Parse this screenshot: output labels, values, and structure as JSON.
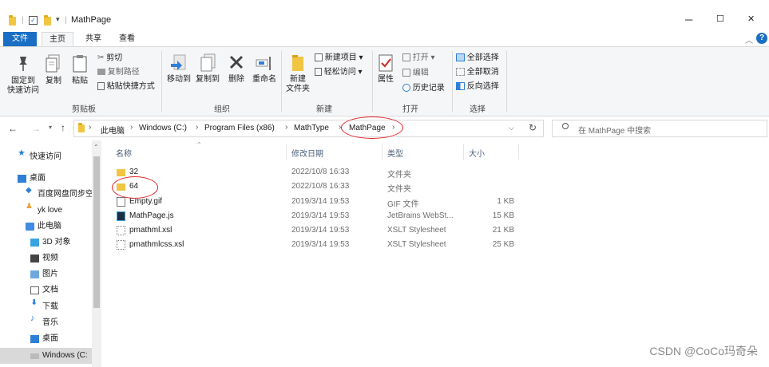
{
  "window": {
    "title": "MathPage",
    "minimize": "─",
    "maximize": "☐",
    "close": "✕"
  },
  "ribbon_tabs": [
    "文件",
    "主页",
    "共享",
    "查看"
  ],
  "ribbon": {
    "clipboard": {
      "pin": "固定到\n快速访问",
      "copy": "复制",
      "paste": "粘贴",
      "cut": "剪切",
      "copy_path": "复制路径",
      "paste_shortcut": "粘贴快捷方式",
      "group": "剪贴板"
    },
    "organize": {
      "move_to": "移动到",
      "copy_to": "复制到",
      "delete": "删除",
      "rename": "重命名",
      "group": "组织"
    },
    "new": {
      "new_folder": "新建\n文件夹",
      "new_item": "新建项目",
      "easy_access": "轻松访问",
      "group": "新建"
    },
    "open": {
      "properties": "属性",
      "open": "打开",
      "edit": "编辑",
      "history": "历史记录",
      "group": "打开"
    },
    "select": {
      "select_all": "全部选择",
      "select_none": "全部取消",
      "invert": "反向选择",
      "group": "选择"
    }
  },
  "address": {
    "crumbs": [
      "此电脑",
      "Windows (C:)",
      "Program Files (x86)",
      "MathType",
      "MathPage"
    ],
    "search_placeholder": "在 MathPage 中搜索"
  },
  "nav": [
    {
      "label": "快速访问",
      "icon": "star-icon"
    },
    {
      "label": "桌面",
      "icon": "desktop-icon"
    },
    {
      "label": "百度网盘同步空",
      "icon": "baidu-icon"
    },
    {
      "label": "yk love",
      "icon": "user-icon"
    },
    {
      "label": "此电脑",
      "icon": "computer-icon"
    },
    {
      "label": "3D 对象",
      "icon": "cube-icon"
    },
    {
      "label": "视频",
      "icon": "video-icon"
    },
    {
      "label": "图片",
      "icon": "picture-icon"
    },
    {
      "label": "文档",
      "icon": "document-icon"
    },
    {
      "label": "下载",
      "icon": "download-icon"
    },
    {
      "label": "音乐",
      "icon": "music-icon"
    },
    {
      "label": "桌面",
      "icon": "desktop-icon"
    },
    {
      "label": "Windows (C:",
      "icon": "drive-icon"
    }
  ],
  "columns": [
    "名称",
    "修改日期",
    "类型",
    "大小"
  ],
  "files": [
    {
      "name": "32",
      "date": "2022/10/8 16:33",
      "type": "文件夹",
      "size": "",
      "icon": "folder-icon"
    },
    {
      "name": "64",
      "date": "2022/10/8 16:33",
      "type": "文件夹",
      "size": "",
      "icon": "folder-icon"
    },
    {
      "name": "Empty.gif",
      "date": "2019/3/14 19:53",
      "type": "GIF 文件",
      "size": "1 KB",
      "icon": "gif-file-icon"
    },
    {
      "name": "MathPage.js",
      "date": "2019/3/14 19:53",
      "type": "JetBrains WebSt...",
      "size": "15 KB",
      "icon": "js-file-icon"
    },
    {
      "name": "pmathml.xsl",
      "date": "2019/3/14 19:53",
      "type": "XSLT Stylesheet",
      "size": "21 KB",
      "icon": "xsl-file-icon"
    },
    {
      "name": "pmathmlcss.xsl",
      "date": "2019/3/14 19:53",
      "type": "XSLT Stylesheet",
      "size": "25 KB",
      "icon": "xsl-file-icon"
    }
  ],
  "watermark": "CSDN @CoCo玛奇朵",
  "colors": {
    "accent": "#1a6fc4",
    "folder": "#f0c542",
    "annotation": "#e0262a"
  }
}
